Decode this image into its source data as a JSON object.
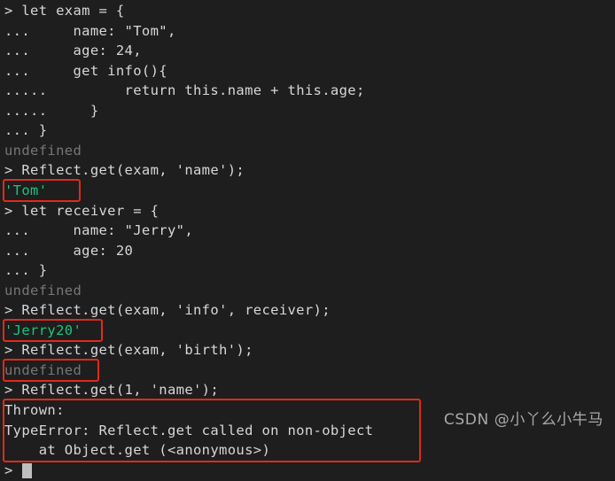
{
  "terminal": {
    "background_color": "#1e1e1e",
    "text_color": "#d7d7d7",
    "dim_color": "#767676",
    "string_color": "#1bc47d",
    "annotation_color": "#e02a1a",
    "prompt_symbol": ">",
    "continuation_short": "...",
    "continuation_long": ".....",
    "lines": [
      {
        "prefix": ">",
        "text": " let exam = {",
        "style": "default"
      },
      {
        "prefix": "...",
        "text": "     name: \"Tom\",",
        "style": "default"
      },
      {
        "prefix": "...",
        "text": "     age: 24,",
        "style": "default"
      },
      {
        "prefix": "...",
        "text": "     get info(){",
        "style": "default"
      },
      {
        "prefix": ".....",
        "text": "         return this.name + this.age;",
        "style": "default"
      },
      {
        "prefix": ".....",
        "text": "     }",
        "style": "default"
      },
      {
        "prefix": "...",
        "text": " }",
        "style": "default"
      },
      {
        "prefix": "",
        "text": "undefined",
        "style": "dim"
      },
      {
        "prefix": ">",
        "text": " Reflect.get(exam, 'name');",
        "style": "default"
      },
      {
        "prefix": "",
        "text": "'Tom'",
        "style": "green"
      },
      {
        "prefix": ">",
        "text": " let receiver = {",
        "style": "default"
      },
      {
        "prefix": "...",
        "text": "     name: \"Jerry\",",
        "style": "default"
      },
      {
        "prefix": "...",
        "text": "     age: 20",
        "style": "default"
      },
      {
        "prefix": "...",
        "text": " }",
        "style": "default"
      },
      {
        "prefix": "",
        "text": "undefined",
        "style": "dim"
      },
      {
        "prefix": ">",
        "text": " Reflect.get(exam, 'info', receiver);",
        "style": "default"
      },
      {
        "prefix": "",
        "text": "'Jerry20'",
        "style": "green"
      },
      {
        "prefix": ">",
        "text": " Reflect.get(exam, 'birth');",
        "style": "default"
      },
      {
        "prefix": "",
        "text": "undefined",
        "style": "dim"
      },
      {
        "prefix": ">",
        "text": " Reflect.get(1, 'name');",
        "style": "default"
      },
      {
        "prefix": "",
        "text": "Thrown:",
        "style": "default"
      },
      {
        "prefix": "",
        "text": "TypeError: Reflect.get called on non-object",
        "style": "default"
      },
      {
        "prefix": "",
        "text": "    at Object.get (<anonymous>)",
        "style": "default"
      }
    ],
    "annotations": [
      {
        "label": "tom-result-highlight",
        "target": "'Tom'"
      },
      {
        "label": "jerry20-result-highlight",
        "target": "'Jerry20'"
      },
      {
        "label": "undefined-result-highlight",
        "target": "undefined"
      },
      {
        "label": "typeerror-highlight",
        "target": "Thrown: TypeError: Reflect.get called on non-object at Object.get (<anonymous>)"
      }
    ],
    "final_prompt": ">"
  },
  "watermark": {
    "text": "CSDN @小丫么小牛马"
  }
}
